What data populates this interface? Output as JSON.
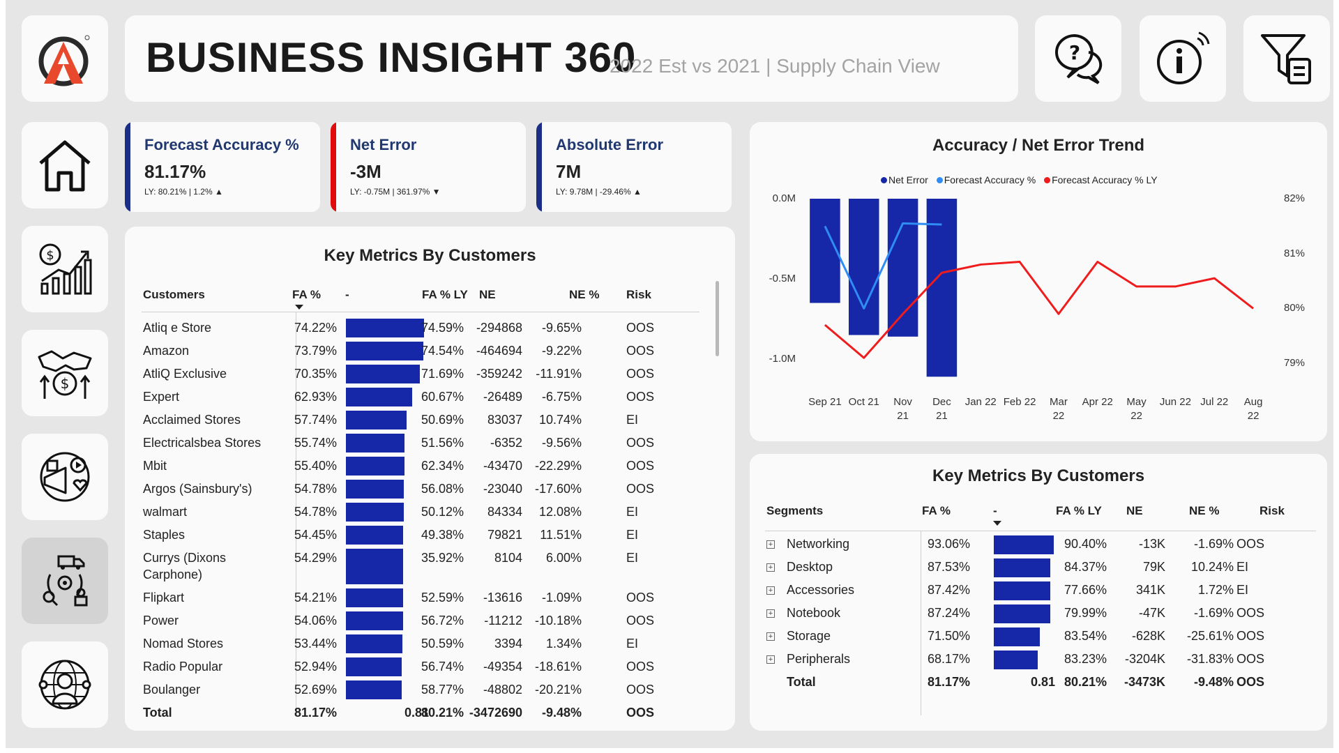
{
  "header": {
    "title": "BUSINESS INSIGHT 360",
    "subtitle": "2022 Est vs 2021 | Supply Chain View"
  },
  "top_icons": [
    "help-chat-icon",
    "info-icon",
    "filter-icon"
  ],
  "nav": [
    "home-icon",
    "finance-icon",
    "sales-icon",
    "marketing-icon",
    "supply-chain-icon",
    "executive-icon"
  ],
  "kpis": [
    {
      "title": "Forecast Accuracy %",
      "value": "81.17%",
      "sub": "LY: 80.21% | 1.2% ▲",
      "color": "#1b2e87"
    },
    {
      "title": "Net Error",
      "value": "-3M",
      "sub": "LY: -0.75M | 361.97% ▼",
      "color": "#e00b0b"
    },
    {
      "title": "Absolute Error",
      "value": "7M",
      "sub": "LY: 9.78M | -29.46% ▲",
      "color": "#1b2e87"
    }
  ],
  "customers_table": {
    "title": "Key Metrics By Customers",
    "headers": [
      "Customers",
      "FA %",
      "-",
      "FA % LY",
      "NE",
      "NE %",
      "Risk"
    ],
    "rows": [
      {
        "name": "Atliq e Store",
        "fa": "74.22%",
        "fa_value": 74.22,
        "fa_ly": "74.59%",
        "ne": "-294868",
        "ne_pct": "-9.65%",
        "risk": "OOS"
      },
      {
        "name": "Amazon",
        "fa": "73.79%",
        "fa_value": 73.79,
        "fa_ly": "74.54%",
        "ne": "-464694",
        "ne_pct": "-9.22%",
        "risk": "OOS"
      },
      {
        "name": "AtliQ Exclusive",
        "fa": "70.35%",
        "fa_value": 70.35,
        "fa_ly": "71.69%",
        "ne": "-359242",
        "ne_pct": "-11.91%",
        "risk": "OOS"
      },
      {
        "name": "Expert",
        "fa": "62.93%",
        "fa_value": 62.93,
        "fa_ly": "60.67%",
        "ne": "-26489",
        "ne_pct": "-6.75%",
        "risk": "OOS"
      },
      {
        "name": "Acclaimed Stores",
        "fa": "57.74%",
        "fa_value": 57.74,
        "fa_ly": "50.69%",
        "ne": "83037",
        "ne_pct": "10.74%",
        "risk": "EI"
      },
      {
        "name": "Electricalsbea Stores",
        "fa": "55.74%",
        "fa_value": 55.74,
        "fa_ly": "51.56%",
        "ne": "-6352",
        "ne_pct": "-9.56%",
        "risk": "OOS"
      },
      {
        "name": "Mbit",
        "fa": "55.40%",
        "fa_value": 55.4,
        "fa_ly": "62.34%",
        "ne": "-43470",
        "ne_pct": "-22.29%",
        "risk": "OOS"
      },
      {
        "name": "Argos (Sainsbury's)",
        "fa": "54.78%",
        "fa_value": 54.78,
        "fa_ly": "56.08%",
        "ne": "-23040",
        "ne_pct": "-17.60%",
        "risk": "OOS"
      },
      {
        "name": "walmart",
        "fa": "54.78%",
        "fa_value": 54.78,
        "fa_ly": "50.12%",
        "ne": "84334",
        "ne_pct": "12.08%",
        "risk": "EI"
      },
      {
        "name": "Staples",
        "fa": "54.45%",
        "fa_value": 54.45,
        "fa_ly": "49.38%",
        "ne": "79821",
        "ne_pct": "11.51%",
        "risk": "EI"
      },
      {
        "name": "Currys (Dixons",
        "name2": "Carphone)",
        "fa": "54.29%",
        "fa_value": 54.29,
        "fa_ly": "35.92%",
        "ne": "8104",
        "ne_pct": "6.00%",
        "risk": "EI"
      },
      {
        "name": "Flipkart",
        "fa": "54.21%",
        "fa_value": 54.21,
        "fa_ly": "52.59%",
        "ne": "-13616",
        "ne_pct": "-1.09%",
        "risk": "OOS"
      },
      {
        "name": "Power",
        "fa": "54.06%",
        "fa_value": 54.06,
        "fa_ly": "56.72%",
        "ne": "-11212",
        "ne_pct": "-10.18%",
        "risk": "OOS"
      },
      {
        "name": "Nomad Stores",
        "fa": "53.44%",
        "fa_value": 53.44,
        "fa_ly": "50.59%",
        "ne": "3394",
        "ne_pct": "1.34%",
        "risk": "EI"
      },
      {
        "name": "Radio Popular",
        "fa": "52.94%",
        "fa_value": 52.94,
        "fa_ly": "56.74%",
        "ne": "-49354",
        "ne_pct": "-18.61%",
        "risk": "OOS"
      },
      {
        "name": "Boulanger",
        "fa": "52.69%",
        "fa_value": 52.69,
        "fa_ly": "58.77%",
        "ne": "-48802",
        "ne_pct": "-20.21%",
        "risk": "OOS"
      }
    ],
    "total": {
      "name": "Total",
      "fa": "81.17%",
      "bar": "0.81",
      "fa_ly": "80.21%",
      "ne": "-3472690",
      "ne_pct": "-9.48%",
      "risk": "OOS"
    }
  },
  "segments_table": {
    "title": "Key Metrics By Customers",
    "headers": [
      "Segments",
      "FA %",
      "-",
      "FA % LY",
      "NE",
      "NE %",
      "Risk"
    ],
    "rows": [
      {
        "name": "Networking",
        "fa": "93.06%",
        "fa_value": 93.06,
        "fa_ly": "90.40%",
        "ne": "-13K",
        "ne_pct": "-1.69%",
        "risk": "OOS"
      },
      {
        "name": "Desktop",
        "fa": "87.53%",
        "fa_value": 87.53,
        "fa_ly": "84.37%",
        "ne": "79K",
        "ne_pct": "10.24%",
        "risk": "EI"
      },
      {
        "name": "Accessories",
        "fa": "87.42%",
        "fa_value": 87.42,
        "fa_ly": "77.66%",
        "ne": "341K",
        "ne_pct": "1.72%",
        "risk": "EI"
      },
      {
        "name": "Notebook",
        "fa": "87.24%",
        "fa_value": 87.24,
        "fa_ly": "79.99%",
        "ne": "-47K",
        "ne_pct": "-1.69%",
        "risk": "OOS"
      },
      {
        "name": "Storage",
        "fa": "71.50%",
        "fa_value": 71.5,
        "fa_ly": "83.54%",
        "ne": "-628K",
        "ne_pct": "-25.61%",
        "risk": "OOS"
      },
      {
        "name": "Peripherals",
        "fa": "68.17%",
        "fa_value": 68.17,
        "fa_ly": "83.23%",
        "ne": "-3204K",
        "ne_pct": "-31.83%",
        "risk": "OOS"
      }
    ],
    "total": {
      "name": "Total",
      "fa": "81.17%",
      "bar": "0.81",
      "fa_ly": "80.21%",
      "ne": "-3473K",
      "ne_pct": "-9.48%",
      "risk": "OOS"
    }
  },
  "chart_data": {
    "type": "bar",
    "title": "Accuracy / Net Error Trend",
    "categories": [
      "Sep 21",
      "Oct 21",
      "Nov 21",
      "Dec 21",
      "Jan 22",
      "Feb 22",
      "Mar 22",
      "Apr 22",
      "May 22",
      "Jun 22",
      "Jul 22",
      "Aug 22"
    ],
    "category_labels": [
      [
        "Sep 21"
      ],
      [
        "Oct 21"
      ],
      [
        "Nov",
        "21"
      ],
      [
        "Dec",
        "21"
      ],
      [
        "Jan 22"
      ],
      [
        "Feb 22"
      ],
      [
        "Mar",
        "22"
      ],
      [
        "Apr 22"
      ],
      [
        "May",
        "22"
      ],
      [
        "Jun 22"
      ],
      [
        "Jul 22"
      ],
      [
        "Aug",
        "22"
      ]
    ],
    "series": [
      {
        "name": "Net Error",
        "type": "bar",
        "axis": "left",
        "color": "#1628a8",
        "values": [
          -0.65,
          -0.85,
          -0.86,
          -1.11,
          null,
          null,
          null,
          null,
          null,
          null,
          null,
          null
        ]
      },
      {
        "name": "Forecast Accuracy %",
        "type": "line",
        "axis": "right",
        "color": "#2f8cf5",
        "values": [
          81.5,
          80.0,
          81.55,
          81.53,
          null,
          null,
          null,
          null,
          null,
          null,
          null,
          null
        ]
      },
      {
        "name": "Forecast Accuracy % LY",
        "type": "line",
        "axis": "right",
        "color": "#ee1c1c",
        "values": [
          79.7,
          79.1,
          79.9,
          80.65,
          80.8,
          80.85,
          79.9,
          80.85,
          80.4,
          80.4,
          80.55,
          80.0
        ]
      }
    ],
    "left_axis": {
      "ticks": [
        "0.0M",
        "-0.5M",
        "-1.0M"
      ],
      "range": [
        -1.2,
        0.0
      ]
    },
    "right_axis": {
      "ticks": [
        "82%",
        "81%",
        "80%",
        "79%"
      ],
      "range": [
        78.6,
        82.0
      ]
    },
    "legend_position": "top-center"
  }
}
